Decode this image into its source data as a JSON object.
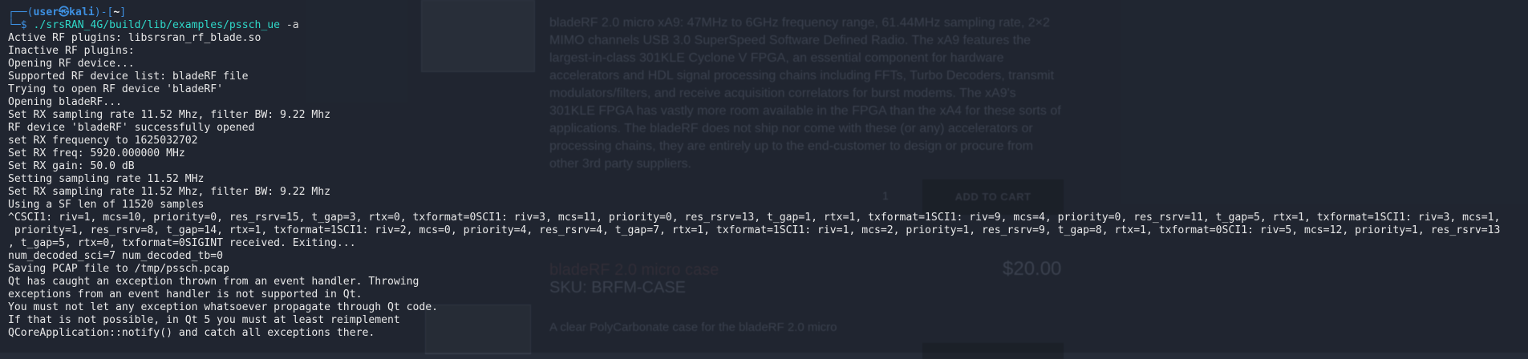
{
  "background_page": {
    "description": "bladeRF 2.0 micro xA9: 47MHz to 6GHz frequency range, 61.44MHz sampling rate, 2×2 MIMO channels USB 3.0 SuperSpeed Software Defined Radio. The xA9 features the largest-in-class 301KLE Cyclone V FPGA, an essential component for hardware accelerators and HDL signal processing chains including FFTs, Turbo Decoders, transmit modulators/filters, and receive acquisition correlators for burst modems. The xA9's 301KLE FPGA has vastly more room available in the FPGA than the xA4 for these sorts of applications. The bladeRF does not ship nor come with these (or any) accelerators or processing chains, they are entirely up to the end-customer to design or procure from other 3rd party suppliers.",
    "quantity": "1",
    "add_to_cart_label": "ADD TO CART",
    "product_title": "bladeRF 2.0 micro case",
    "sku": "SKU: BRFM-CASE",
    "price": "$20.00",
    "case_description": "A clear PolyCarbonate case for the bladeRF 2.0 micro"
  },
  "terminal": {
    "prompt": {
      "frame_top": "┌──(",
      "user": "user㉿kali",
      "frame_mid": ")-[",
      "cwd": "~",
      "frame_end": "]",
      "frame_bottom": "└─$ ",
      "command": "./srsRAN_4G/build/lib/examples/pssch_ue",
      "option": " -a"
    },
    "lines": [
      "Active RF plugins: libsrsran_rf_blade.so",
      "Inactive RF plugins:",
      "Opening RF device...",
      "Supported RF device list: bladeRF file",
      "Trying to open RF device 'bladeRF'",
      "Opening bladeRF...",
      "Set RX sampling rate 11.52 Mhz, filter BW: 9.22 Mhz",
      "RF device 'bladeRF' successfully opened",
      "set RX frequency to 1625032702",
      "Set RX freq: 5920.000000 MHz",
      "Set RX gain: 50.0 dB",
      "Setting sampling rate 11.52 MHz",
      "Set RX sampling rate 11.52 Mhz, filter BW: 9.22 Mhz",
      "Using a SF len of 11520 samples",
      "^CSCI1: riv=1, mcs=10, priority=0, res_rsrv=15, t_gap=3, rtx=0, txformat=0SCI1: riv=3, mcs=11, priority=0, res_rsrv=13, t_gap=1, rtx=1, txformat=1SCI1: riv=9, mcs=4, priority=0, res_rsrv=11, t_gap=5, rtx=1, txformat=1SCI1: riv=3, mcs=1,",
      " priority=1, res_rsrv=8, t_gap=14, rtx=1, txformat=1SCI1: riv=2, mcs=0, priority=4, res_rsrv=4, t_gap=7, rtx=1, txformat=1SCI1: riv=1, mcs=2, priority=1, res_rsrv=9, t_gap=8, rtx=1, txformat=0SCI1: riv=5, mcs=12, priority=1, res_rsrv=13",
      ", t_gap=5, rtx=0, txformat=0SIGINT received. Exiting...",
      "num_decoded_sci=7 num_decoded_tb=0",
      "Saving PCAP file to /tmp/pssch.pcap",
      "Qt has caught an exception thrown from an event handler. Throwing",
      "exceptions from an event handler is not supported in Qt.",
      "You must not let any exception whatsoever propagate through Qt code.",
      "If that is not possible, in Qt 5 you must at least reimplement",
      "QCoreApplication::notify() and catch all exceptions there."
    ]
  },
  "colors": {
    "prompt_frame": "#3d8fe0",
    "command": "#2fd9c9",
    "text": "#e8e8e8",
    "background": "#262c38"
  }
}
